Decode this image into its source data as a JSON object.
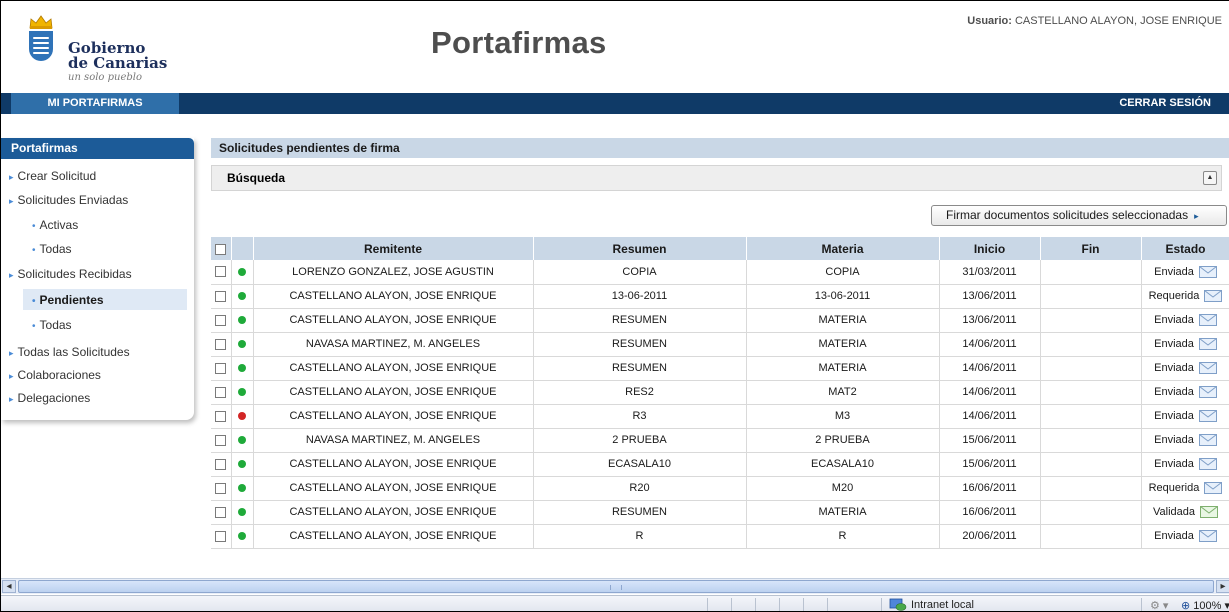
{
  "header": {
    "logo_line1": "Gobierno",
    "logo_line2": "de Canarias",
    "logo_tagline": "un solo pueblo",
    "app_title": "Portafirmas",
    "user_label": "Usuario:",
    "user_name": "CASTELLANO ALAYON, JOSE ENRIQUE"
  },
  "topnav": {
    "tab": "MI PORTAFIRMAS",
    "logout": "CERRAR SESIÓN"
  },
  "sidebar": {
    "title": "Portafirmas",
    "items": [
      {
        "label": "Crear Solicitud"
      },
      {
        "label": "Solicitudes Enviadas"
      },
      {
        "label": "Activas"
      },
      {
        "label": "Todas"
      },
      {
        "label": "Solicitudes Recibidas"
      },
      {
        "label": "Pendientes"
      },
      {
        "label": "Todas"
      },
      {
        "label": "Todas las Solicitudes"
      },
      {
        "label": "Colaboraciones"
      },
      {
        "label": "Delegaciones"
      }
    ]
  },
  "main": {
    "section_title": "Solicitudes pendientes de firma",
    "search_label": "Búsqueda",
    "sign_button": "Firmar documentos solicitudes seleccionadas",
    "columns": [
      "Remitente",
      "Resumen",
      "Materia",
      "Inicio",
      "Fin",
      "Estado"
    ],
    "rows": [
      {
        "remitente": "LORENZO GONZALEZ, JOSE AGUSTIN",
        "resumen": "COPIA",
        "materia": "COPIA",
        "inicio": "31/03/2011",
        "fin": "",
        "estado": "Enviada",
        "status": "green"
      },
      {
        "remitente": "CASTELLANO ALAYON, JOSE ENRIQUE",
        "resumen": "13-06-2011",
        "materia": "13-06-2011",
        "inicio": "13/06/2011",
        "fin": "",
        "estado": "Requerida",
        "status": "green"
      },
      {
        "remitente": "CASTELLANO ALAYON, JOSE ENRIQUE",
        "resumen": "RESUMEN",
        "materia": "MATERIA",
        "inicio": "13/06/2011",
        "fin": "",
        "estado": "Enviada",
        "status": "green"
      },
      {
        "remitente": "NAVASA MARTINEZ, M. ANGELES",
        "resumen": "RESUMEN",
        "materia": "MATERIA",
        "inicio": "14/06/2011",
        "fin": "",
        "estado": "Enviada",
        "status": "green"
      },
      {
        "remitente": "CASTELLANO ALAYON, JOSE ENRIQUE",
        "resumen": "RESUMEN",
        "materia": "MATERIA",
        "inicio": "14/06/2011",
        "fin": "",
        "estado": "Enviada",
        "status": "green"
      },
      {
        "remitente": "CASTELLANO ALAYON, JOSE ENRIQUE",
        "resumen": "RES2",
        "materia": "MAT2",
        "inicio": "14/06/2011",
        "fin": "",
        "estado": "Enviada",
        "status": "green"
      },
      {
        "remitente": "CASTELLANO ALAYON, JOSE ENRIQUE",
        "resumen": "R3",
        "materia": "M3",
        "inicio": "14/06/2011",
        "fin": "",
        "estado": "Enviada",
        "status": "red"
      },
      {
        "remitente": "NAVASA MARTINEZ, M. ANGELES",
        "resumen": "2 PRUEBA",
        "materia": "2 PRUEBA",
        "inicio": "15/06/2011",
        "fin": "",
        "estado": "Enviada",
        "status": "green"
      },
      {
        "remitente": "CASTELLANO ALAYON, JOSE ENRIQUE",
        "resumen": "ECASALA10",
        "materia": "ECASALA10",
        "inicio": "15/06/2011",
        "fin": "",
        "estado": "Enviada",
        "status": "green"
      },
      {
        "remitente": "CASTELLANO ALAYON, JOSE ENRIQUE",
        "resumen": "R20",
        "materia": "M20",
        "inicio": "16/06/2011",
        "fin": "",
        "estado": "Requerida",
        "status": "green"
      },
      {
        "remitente": "CASTELLANO ALAYON, JOSE ENRIQUE",
        "resumen": "RESUMEN",
        "materia": "MATERIA",
        "inicio": "16/06/2011",
        "fin": "",
        "estado": "Validada",
        "status": "green"
      },
      {
        "remitente": "CASTELLANO ALAYON, JOSE ENRIQUE",
        "resumen": "R",
        "materia": "R",
        "inicio": "20/06/2011",
        "fin": "",
        "estado": "Enviada",
        "status": "green"
      }
    ]
  },
  "statusbar": {
    "zone": "Intranet local",
    "zoom": "100%"
  },
  "colors": {
    "nav_dark": "#0f3a67",
    "nav_tab": "#2f6fa9",
    "sidebar_head": "#1c5b98",
    "table_head": "#c9d7e6",
    "status_ok": "#1faa3a",
    "status_err": "#d22525"
  }
}
